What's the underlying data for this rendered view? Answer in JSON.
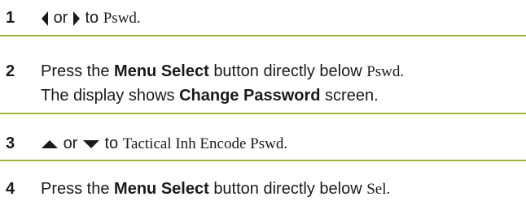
{
  "steps": [
    {
      "number": "1",
      "left_icon": "left-arrow-icon",
      "or": "or",
      "right_icon": "right-arrow-icon",
      "to": "to",
      "target": "Pswd."
    },
    {
      "number": "2",
      "press": "Press the",
      "button_name": "Menu Select",
      "rest": "button directly below",
      "target": "Pswd.",
      "line2_prefix": "The display shows",
      "screen_name": "Change Password",
      "line2_suffix": "screen."
    },
    {
      "number": "3",
      "up_icon": "up-arrow-icon",
      "or": "or",
      "down_icon": "down-arrow-icon",
      "to": "to",
      "target": "Tactical Inh Encode Pswd."
    },
    {
      "number": "4",
      "press": "Press the",
      "button_name": "Menu Select",
      "rest": "button directly below",
      "target": "Sel."
    }
  ],
  "colors": {
    "rule": "#a8b13a",
    "text": "#1a1a1a"
  }
}
